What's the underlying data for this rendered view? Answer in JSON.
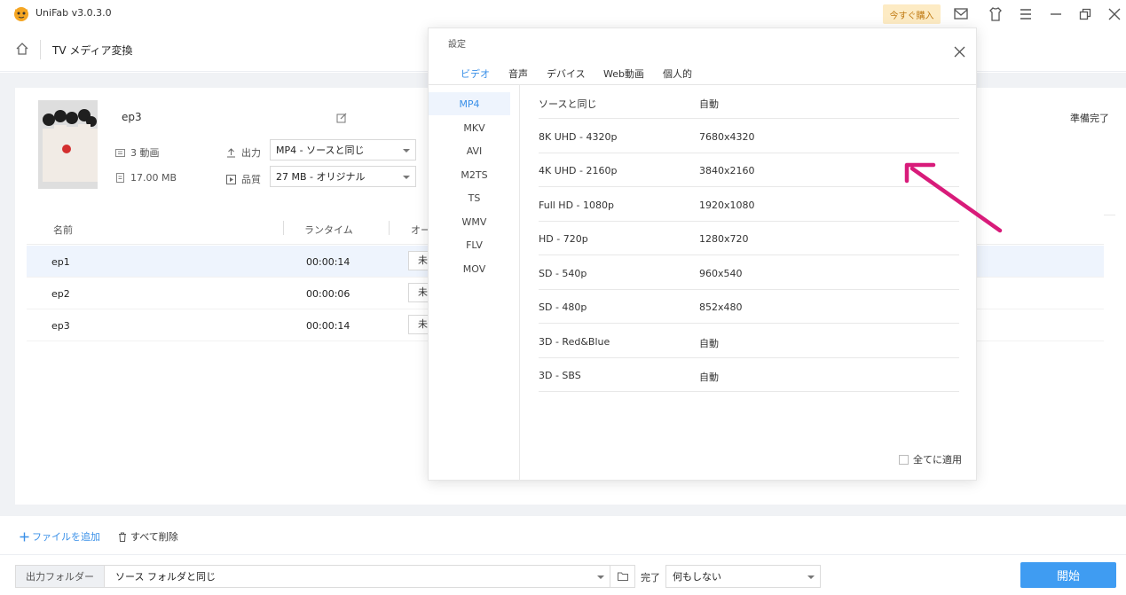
{
  "app": {
    "title": "UniFab v3.0.3.0",
    "buy_label": "今すぐ購入"
  },
  "header": {
    "title": "TV メディア変換"
  },
  "file": {
    "name": "ep3",
    "video_count": "3 動画",
    "size": "17.00 MB",
    "output_label": "出力",
    "output_value": "MP4 - ソースと同じ",
    "quality_label": "品質",
    "quality_value": "27 MB - オリジナル",
    "status": "準備完了"
  },
  "table": {
    "headers": {
      "name": "名前",
      "runtime": "ランタイム",
      "audio": "オー"
    },
    "rows": [
      {
        "name": "ep1",
        "runtime": "00:00:14",
        "btn": "未"
      },
      {
        "name": "ep2",
        "runtime": "00:00:06",
        "btn": "未"
      },
      {
        "name": "ep3",
        "runtime": "00:00:14",
        "btn": "未"
      }
    ]
  },
  "actions": {
    "add_file": "ファイルを追加",
    "delete_all": "すべて削除"
  },
  "footer": {
    "output_folder_label": "出力フォルダー",
    "output_folder_value": "ソース フォルダと同じ",
    "done_label": "完了",
    "done_value": "何もしない",
    "start_label": "開始"
  },
  "dialog": {
    "title": "設定",
    "tabs": [
      "ビデオ",
      "音声",
      "デバイス",
      "Web動画",
      "個人的"
    ],
    "formats": [
      "MP4",
      "MKV",
      "AVI",
      "M2TS",
      "TS",
      "WMV",
      "FLV",
      "MOV"
    ],
    "resolutions": [
      {
        "name": "ソースと同じ",
        "value": "自動"
      },
      {
        "name": "8K UHD - 4320p",
        "value": "7680x4320"
      },
      {
        "name": "4K UHD - 2160p",
        "value": "3840x2160"
      },
      {
        "name": "Full HD - 1080p",
        "value": "1920x1080"
      },
      {
        "name": "HD - 720p",
        "value": "1280x720"
      },
      {
        "name": "SD - 540p",
        "value": "960x540"
      },
      {
        "name": "SD - 480p",
        "value": "852x480"
      },
      {
        "name": "3D - Red&Blue",
        "value": "自動"
      },
      {
        "name": "3D - SBS",
        "value": "自動"
      }
    ],
    "apply_all_label": "全てに適用"
  },
  "colors": {
    "accent": "#3a90e8",
    "start_button": "#3f9cf2",
    "annotation_arrow": "#d81b7a"
  }
}
